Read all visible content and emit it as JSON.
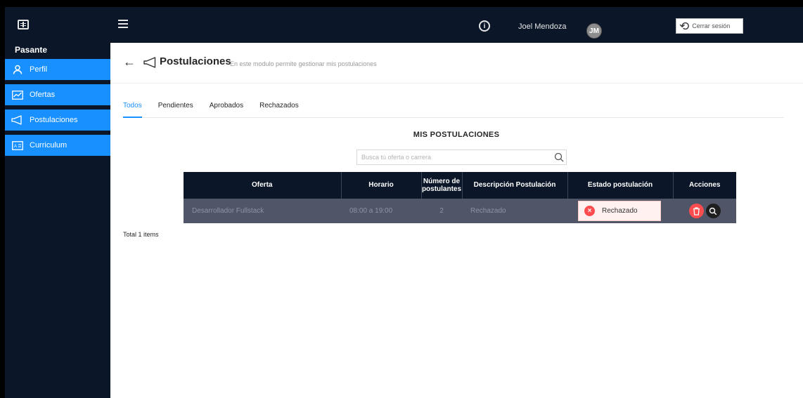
{
  "sidebar": {
    "section_title": "Pasante",
    "items": [
      {
        "label": "Perfil",
        "icon": "user-icon"
      },
      {
        "label": "Ofertas",
        "icon": "chart-icon"
      },
      {
        "label": "Postulaciones",
        "icon": "megaphone-icon"
      },
      {
        "label": "Curriculum",
        "icon": "id-card-icon"
      }
    ]
  },
  "topbar": {
    "user_name": "Joel Mendoza",
    "avatar_initials": "JM",
    "info_glyph": "i",
    "logout_label": "Cerrar sesión"
  },
  "header": {
    "title": "Postulaciones",
    "subtitle": "En este modulo permite gestionar mis postulaciones"
  },
  "tabs": [
    {
      "label": "Todos",
      "active": true
    },
    {
      "label": "Pendientes",
      "active": false
    },
    {
      "label": "Aprobados",
      "active": false
    },
    {
      "label": "Rechazados",
      "active": false
    }
  ],
  "section_heading": "MIS POSTULACIONES",
  "search": {
    "placeholder": "Busca tú oferta o carrera",
    "value": ""
  },
  "table": {
    "columns": [
      "Oferta",
      "Horario",
      "Número de postulantes",
      "Descripción Postulación",
      "Estado postulación",
      "Acciones"
    ],
    "rows": [
      {
        "oferta": "Desarrollador Fullstack",
        "horario": "08:00 a 19:00",
        "postulantes": "2",
        "descripcion": "Rechazado",
        "estado": "Rechazado",
        "estado_glyph": "×"
      }
    ]
  },
  "total": "Total 1 items",
  "colors": {
    "sidebar_bg": "#0b1629",
    "accent": "#1890ff",
    "danger": "#ff4d4f"
  }
}
